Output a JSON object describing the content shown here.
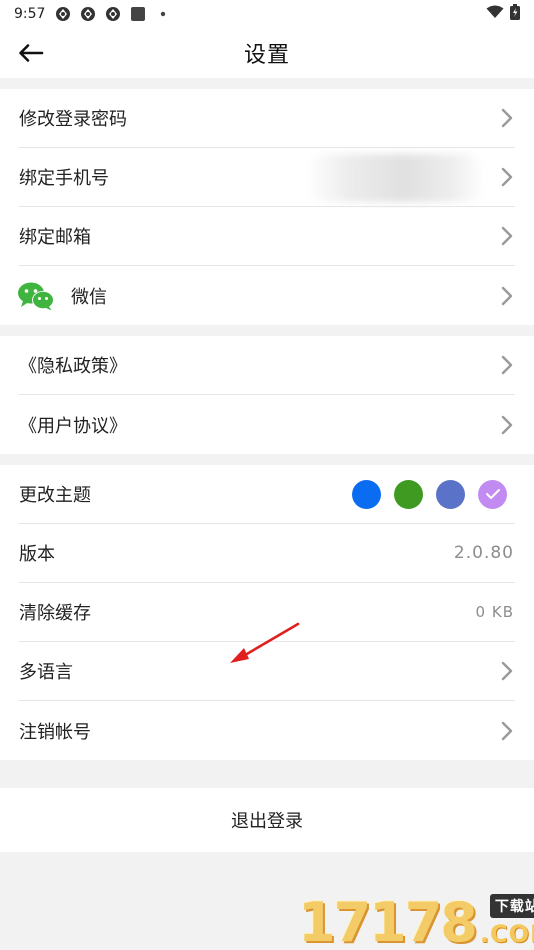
{
  "status": {
    "time": "9:57",
    "icons": [
      "notification-icon",
      "notification-icon",
      "notification-icon",
      "app-icon",
      "dot-icon"
    ],
    "right_icons": [
      "wifi-icon",
      "battery-icon"
    ]
  },
  "header": {
    "title": "设置",
    "back_icon": "back-arrow-icon"
  },
  "account": [
    {
      "label": "修改登录密码"
    },
    {
      "label": "绑定手机号"
    },
    {
      "label": "绑定邮箱"
    },
    {
      "label": "微信",
      "icon": "wechat-icon"
    }
  ],
  "policies": [
    {
      "label": "《隐私政策》"
    },
    {
      "label": "《用户协议》"
    }
  ],
  "general": {
    "theme": {
      "label": "更改主题",
      "colors": [
        "#0a6cf0",
        "#3f9a21",
        "#5a73c9",
        "#c28bf2"
      ],
      "selected_index": 3
    },
    "version": {
      "label": "版本",
      "value": "2.0.80"
    },
    "cache": {
      "label": "清除缓存",
      "value": "0 KB"
    },
    "language": {
      "label": "多语言"
    },
    "cancel_account": {
      "label": "注销帐号"
    }
  },
  "logout": {
    "label": "退出登录"
  },
  "watermark": {
    "number": "17178",
    "tag": "下载站",
    "suffix": ".COM"
  },
  "colors": {
    "accent_arrow": "#e0201e",
    "chevron": "#9a9a9a",
    "wechat": "#3fb53f"
  }
}
